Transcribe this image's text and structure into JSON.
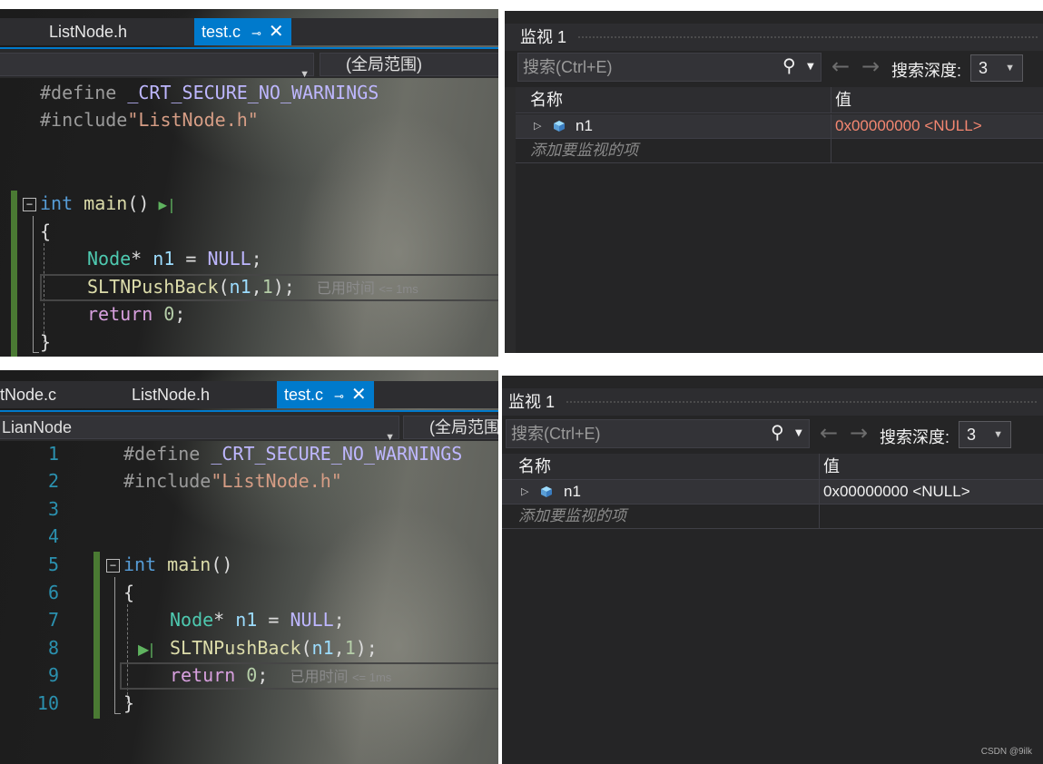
{
  "top": {
    "editor": {
      "tabs": [
        {
          "label": "ListNode.h"
        },
        {
          "label": "test.c",
          "active": true,
          "pin_icon": "pin-icon",
          "close_icon": "close-icon"
        }
      ],
      "scope": "(全局范围)",
      "lines": {
        "l1a": "#define ",
        "l1b": "_CRT_SECURE_NO_WARNINGS",
        "l2a": "#include",
        "l2b": "\"ListNode.h\"",
        "l5a": "int",
        "l5b": " main",
        "l5c": "()",
        "l6": "{",
        "l7a": "Node",
        "l7b": "* ",
        "l7c": "n1",
        "l7d": " = ",
        "l7e": "NULL",
        "l7f": ";",
        "l8a": "SLTNPushBack",
        "l8b": "(",
        "l8c": "n1",
        "l8d": ",",
        "l8e": "1",
        "l8f": ");",
        "l9a": "return",
        "l9b": " ",
        "l9c": "0",
        "l9d": ";",
        "l10": "}"
      },
      "perf_hint": "已用时间",
      "perf_value": "<= 1ms"
    },
    "watch": {
      "title": "监视 1",
      "search_placeholder": "搜索(Ctrl+E)",
      "depth_label": "搜索深度:",
      "depth_value": "3",
      "col_name": "名称",
      "col_value": "值",
      "rows": [
        {
          "name": "n1",
          "value": "0x00000000 <NULL>",
          "value_color": "#f48771"
        }
      ],
      "add_hint": "添加要监视的项"
    }
  },
  "bottom": {
    "editor": {
      "tabs": [
        {
          "label": "tNode.c"
        },
        {
          "label": "ListNode.h"
        },
        {
          "label": "test.c",
          "active": true
        }
      ],
      "project": "LianNode",
      "scope": "(全局范围",
      "line_numbers": [
        "1",
        "2",
        "3",
        "4",
        "5",
        "6",
        "7",
        "8",
        "9",
        "10"
      ],
      "perf_hint": "已用时间",
      "perf_value": "<= 1ms"
    },
    "watch": {
      "title": "监视 1",
      "search_placeholder": "搜索(Ctrl+E)",
      "depth_label": "搜索深度:",
      "depth_value": "3",
      "col_name": "名称",
      "col_value": "值",
      "rows": [
        {
          "name": "n1",
          "value": "0x00000000 <NULL>",
          "value_color": "#f1f1f1"
        }
      ],
      "add_hint": "添加要监视的项"
    }
  },
  "watermark": "CSDN @9ilk",
  "colors": {
    "accent": "#007acc",
    "changed_value": "#f48771",
    "debug_green": "#4a7a33"
  }
}
